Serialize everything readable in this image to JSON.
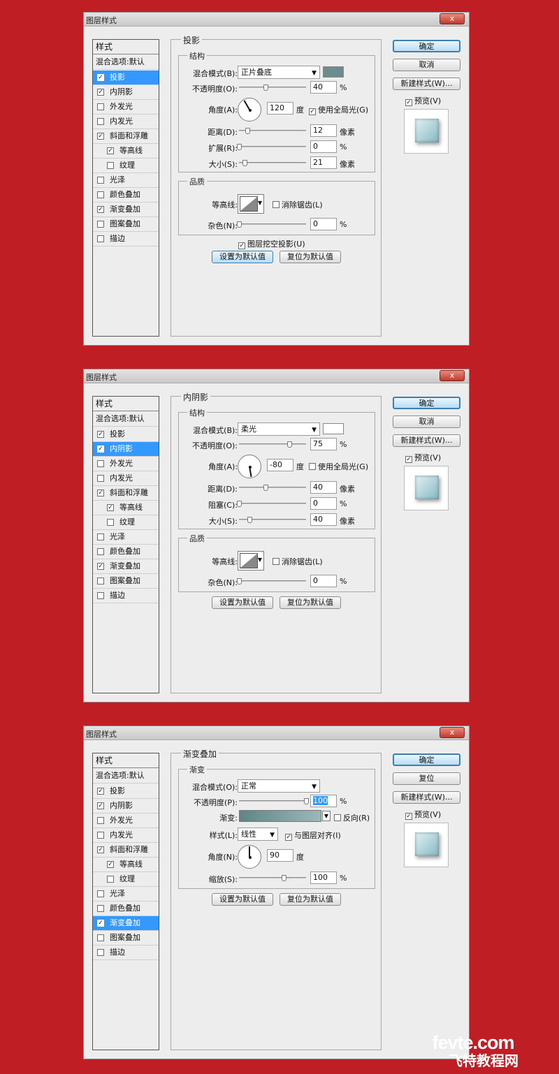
{
  "styles_list": {
    "header": "样式",
    "blend_options": "混合选项:默认",
    "items": [
      {
        "label": "投影",
        "sub": false
      },
      {
        "label": "内阴影",
        "sub": false
      },
      {
        "label": "外发光",
        "sub": false
      },
      {
        "label": "内发光",
        "sub": false
      },
      {
        "label": "斜面和浮雕",
        "sub": false
      },
      {
        "label": "等高线",
        "sub": true
      },
      {
        "label": "纹理",
        "sub": true
      },
      {
        "label": "光泽",
        "sub": false
      },
      {
        "label": "颜色叠加",
        "sub": false
      },
      {
        "label": "渐变叠加",
        "sub": false
      },
      {
        "label": "图案叠加",
        "sub": false
      },
      {
        "label": "描边",
        "sub": false
      }
    ]
  },
  "dialog1": {
    "title": "图层样式",
    "close": "x",
    "checks": [
      true,
      true,
      false,
      false,
      true,
      true,
      false,
      false,
      false,
      true,
      false,
      false
    ],
    "selected_index": 0,
    "panel_title": "投影",
    "structure": {
      "title": "结构",
      "blend_mode_label": "混合模式(B):",
      "blend_mode": "正片叠底",
      "blend_swatch": "#6d8c8e",
      "opacity_label": "不透明度(O):",
      "opacity": "40",
      "opacity_unit": "%",
      "angle_label": "角度(A):",
      "angle": "120",
      "angle_unit": "度",
      "global_light": {
        "label": "使用全局光(G)",
        "checked": true
      },
      "distance_label": "距离(D):",
      "distance": "12",
      "distance_unit": "像素",
      "spread_label": "扩展(R):",
      "spread": "0",
      "spread_unit": "%",
      "size_label": "大小(S):",
      "size": "21",
      "size_unit": "像素"
    },
    "quality": {
      "title": "品质",
      "contour_label": "等高线:",
      "antialias": {
        "label": "消除锯齿(L)",
        "checked": false
      },
      "noise_label": "杂色(N):",
      "noise": "0",
      "noise_unit": "%"
    },
    "knockout": {
      "label": "图层挖空投影(U)",
      "checked": true
    },
    "make_default": "设置为默认值",
    "reset_default": "复位为默认值",
    "ok": "确定",
    "second_button": "取消",
    "new_style": "新建样式(W)...",
    "preview": {
      "label": "预览(V)",
      "checked": true
    }
  },
  "dialog2": {
    "title": "图层样式",
    "close": "x",
    "checks": [
      true,
      true,
      false,
      false,
      true,
      true,
      false,
      false,
      false,
      true,
      false,
      false
    ],
    "selected_index": 1,
    "panel_title": "内阴影",
    "structure": {
      "title": "结构",
      "blend_mode_label": "混合模式(B):",
      "blend_mode": "柔光",
      "blend_swatch": "#ffffff",
      "opacity_label": "不透明度(O):",
      "opacity": "75",
      "opacity_unit": "%",
      "angle_label": "角度(A):",
      "angle": "-80",
      "angle_unit": "度",
      "global_light": {
        "label": "使用全局光(G)",
        "checked": false
      },
      "distance_label": "距离(D):",
      "distance": "40",
      "distance_unit": "像素",
      "choke_label": "阻塞(C):",
      "choke": "0",
      "choke_unit": "%",
      "size_label": "大小(S):",
      "size": "40",
      "size_unit": "像素"
    },
    "quality": {
      "title": "品质",
      "contour_label": "等高线:",
      "antialias": {
        "label": "消除锯齿(L)",
        "checked": false
      },
      "noise_label": "杂色(N):",
      "noise": "0",
      "noise_unit": "%"
    },
    "make_default": "设置为默认值",
    "reset_default": "复位为默认值",
    "ok": "确定",
    "second_button": "取消",
    "new_style": "新建样式(W)...",
    "preview": {
      "label": "预览(V)",
      "checked": true
    }
  },
  "dialog3": {
    "title": "图层样式",
    "close": "x",
    "checks": [
      true,
      true,
      false,
      false,
      true,
      true,
      false,
      false,
      false,
      true,
      false,
      false
    ],
    "selected_index": 9,
    "panel_title": "渐变叠加",
    "gradient_group": {
      "title": "渐变",
      "blend_mode_label": "混合模式(O):",
      "blend_mode": "正常",
      "opacity_label": "不透明度(P):",
      "opacity": "100",
      "opacity_unit": "%",
      "gradient_label": "渐变:",
      "gradient_colors": [
        "#5f8586",
        "#9db7b9"
      ],
      "reverse": {
        "label": "反向(R)",
        "checked": false
      },
      "style_label": "样式(L):",
      "style": "线性",
      "align": {
        "label": "与图层对齐(I)",
        "checked": true
      },
      "angle_label": "角度(N):",
      "angle": "90",
      "angle_unit": "度",
      "scale_label": "缩放(S):",
      "scale": "100",
      "scale_unit": "%"
    },
    "make_default": "设置为默认值",
    "reset_default": "复位为默认值",
    "ok": "确定",
    "second_button": "复位",
    "new_style": "新建样式(W)...",
    "preview": {
      "label": "预览(V)",
      "checked": true
    }
  },
  "watermark": {
    "line1": "fevte.com",
    "line2": "飞特教程网"
  }
}
